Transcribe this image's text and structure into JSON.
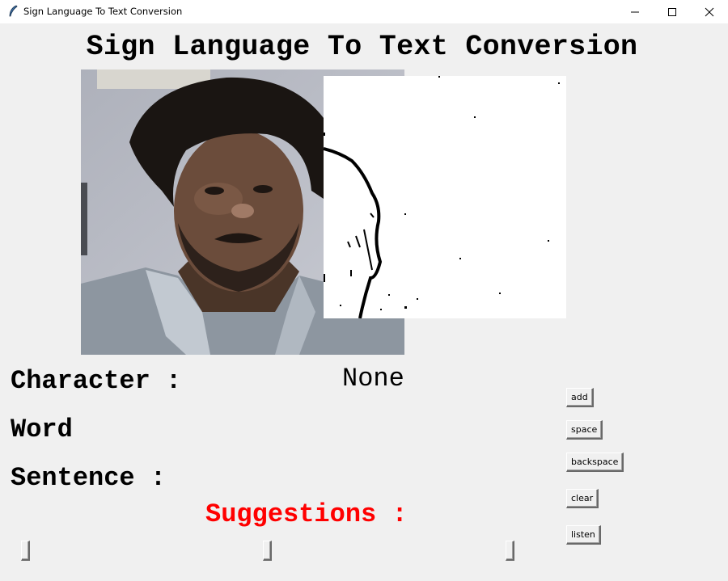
{
  "window": {
    "title": "Sign Language To Text Conversion",
    "app_icon": "tk-feather-icon",
    "controls": {
      "minimize": "minimize-icon",
      "maximize": "maximize-icon",
      "close": "close-icon"
    }
  },
  "heading": "Sign Language To Text Conversion",
  "panels": {
    "camera": "webcam-feed",
    "processed": "processed-hand-image"
  },
  "fields": {
    "character_label": "Character :",
    "character_value": "None",
    "word_label": "Word",
    "word_value": "",
    "sentence_label": "Sentence :",
    "sentence_value": "",
    "suggestions_label": "Suggestions :"
  },
  "buttons": {
    "add": "add",
    "space": "space",
    "backspace": "backspace",
    "clear": "clear",
    "listen": "listen"
  },
  "suggestions": [
    "",
    "",
    ""
  ],
  "colors": {
    "background": "#f0f0f0",
    "suggestions_label": "#ff0000"
  }
}
